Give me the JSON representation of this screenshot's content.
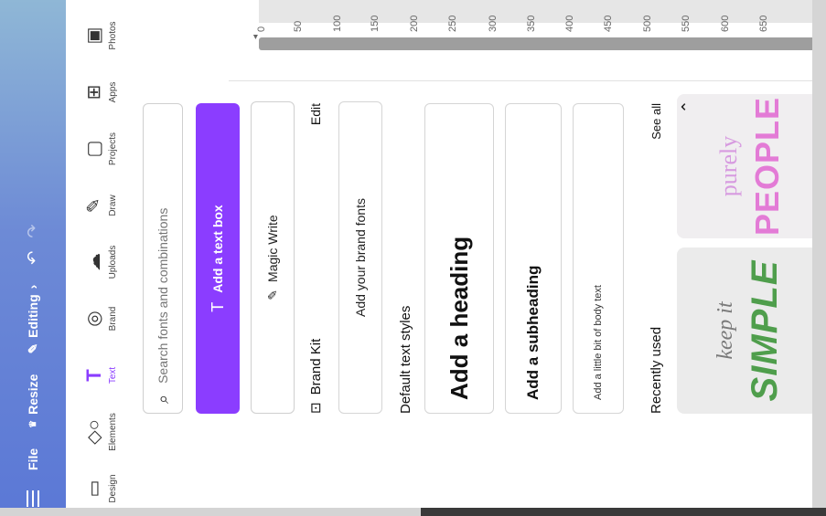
{
  "header": {
    "menu_icon": "hamburger-icon",
    "file_label": "File",
    "resize_label": "Resize",
    "editing_label": "Editing",
    "undo_icon": "undo-icon",
    "redo_icon": "redo-icon"
  },
  "rail": {
    "items": [
      {
        "label": "Design",
        "icon": "layout-icon"
      },
      {
        "label": "Elements",
        "icon": "shapes-icon"
      },
      {
        "label": "Text",
        "icon": "text-icon"
      },
      {
        "label": "Brand",
        "icon": "brand-icon"
      },
      {
        "label": "Uploads",
        "icon": "cloud-upload-icon"
      },
      {
        "label": "Draw",
        "icon": "pen-icon"
      },
      {
        "label": "Projects",
        "icon": "folder-icon"
      },
      {
        "label": "Apps",
        "icon": "apps-icon"
      },
      {
        "label": "Photos",
        "icon": "photo-icon"
      }
    ],
    "active_color": "#8b3dff"
  },
  "panel": {
    "search_placeholder": "Search fonts and combinations",
    "add_text_label": "Add a text box",
    "magic_write_label": "Magic Write",
    "brand_kit_label": "Brand Kit",
    "edit_label": "Edit",
    "brand_fonts_label": "Add your brand fonts",
    "default_styles_label": "Default text styles",
    "heading_label": "Add a heading",
    "subheading_label": "Add a subheading",
    "body_label": "Add a little bit of body text",
    "recently_used_label": "Recently used",
    "see_all_label": "See all",
    "thumb1": {
      "line1": "keep it",
      "line2": "SIMPLE"
    },
    "thumb2": {
      "line1": "purely",
      "line2": "PEOPLE"
    }
  },
  "ruler": {
    "ticks": [
      "0",
      "50",
      "100",
      "150",
      "200",
      "250",
      "300",
      "350",
      "400",
      "450",
      "500",
      "550",
      "600",
      "650"
    ]
  },
  "colors": {
    "accent": "#8b3dff",
    "header_start": "#5b78d6",
    "header_end": "#8fb7d6"
  }
}
